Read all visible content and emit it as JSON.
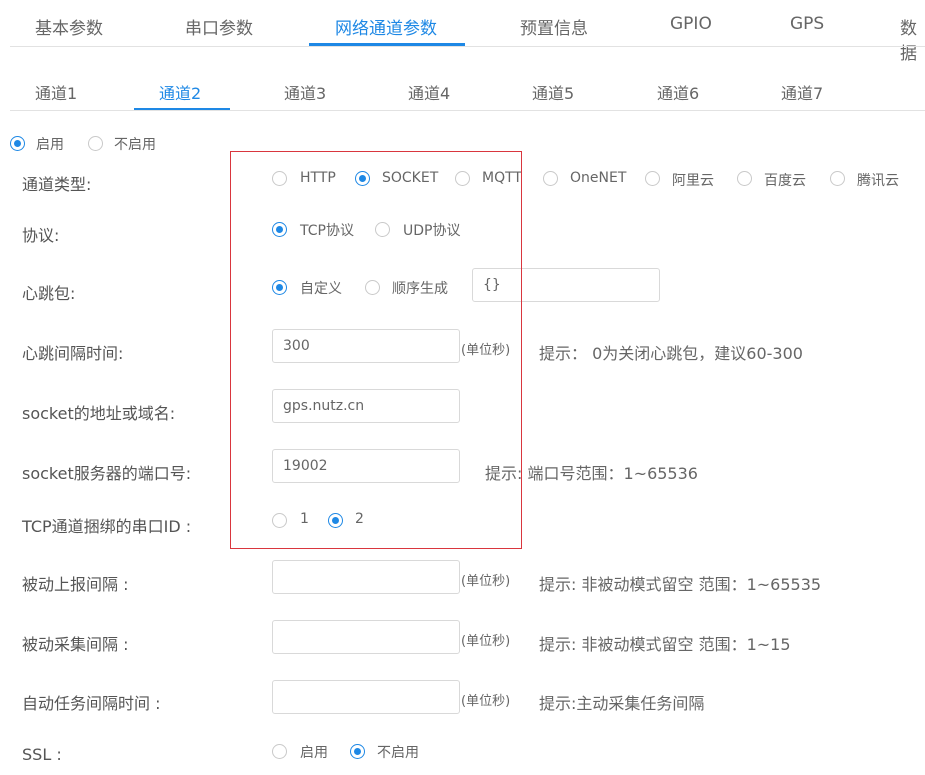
{
  "top_tabs": [
    "基本参数",
    "串口参数",
    "网络通道参数",
    "预置信息",
    "GPIO",
    "GPS",
    "数据"
  ],
  "channel_tabs": [
    "通道1",
    "通道2",
    "通道3",
    "通道4",
    "通道5",
    "通道6",
    "通道7"
  ],
  "enable": {
    "on": "启用",
    "off": "不启用"
  },
  "fields": {
    "channel_type": {
      "label": "通道类型:",
      "options": [
        "HTTP",
        "SOCKET",
        "MQTT",
        "OneNET",
        "阿里云",
        "百度云",
        "腾讯云"
      ],
      "selected": "SOCKET"
    },
    "protocol": {
      "label": "协议:",
      "options": [
        "TCP协议",
        "UDP协议"
      ],
      "selected": "TCP协议"
    },
    "heartbeat": {
      "label": "心跳包:",
      "options": [
        "自定义",
        "顺序生成"
      ],
      "selected": "自定义",
      "value": "{}"
    },
    "heartbeat_interval": {
      "label": "心跳间隔时间:",
      "value": "300",
      "unit": "(单位秒)",
      "hint": "提示： 0为关闭心跳包，建议60-300"
    },
    "socket_host": {
      "label": "socket的地址或域名:",
      "value": "gps.nutz.cn"
    },
    "socket_port": {
      "label": "socket服务器的端口号:",
      "value": "19002",
      "hint": "提示: 端口号范围：1~65536"
    },
    "tcp_uart_id": {
      "label": "TCP通道捆绑的串口ID :",
      "options": [
        "1",
        "2"
      ],
      "selected": "2"
    },
    "passive_report": {
      "label": "被动上报间隔 :",
      "value": "",
      "unit": "(单位秒)",
      "hint": "提示: 非被动模式留空 范围：1~65535"
    },
    "passive_collect": {
      "label": "被动采集间隔 :",
      "value": "",
      "unit": "(单位秒)",
      "hint": "提示: 非被动模式留空 范围：1~15"
    },
    "auto_task": {
      "label": "自动任务间隔时间 :",
      "value": "",
      "unit": "(单位秒)",
      "hint": "提示:主动采集任务间隔"
    },
    "ssl": {
      "label": "SSL :",
      "options": [
        "启用",
        "不启用"
      ],
      "selected": "不启用"
    }
  },
  "colors": {
    "accent": "#1e88e5",
    "highlight_box": "#d9363e"
  }
}
